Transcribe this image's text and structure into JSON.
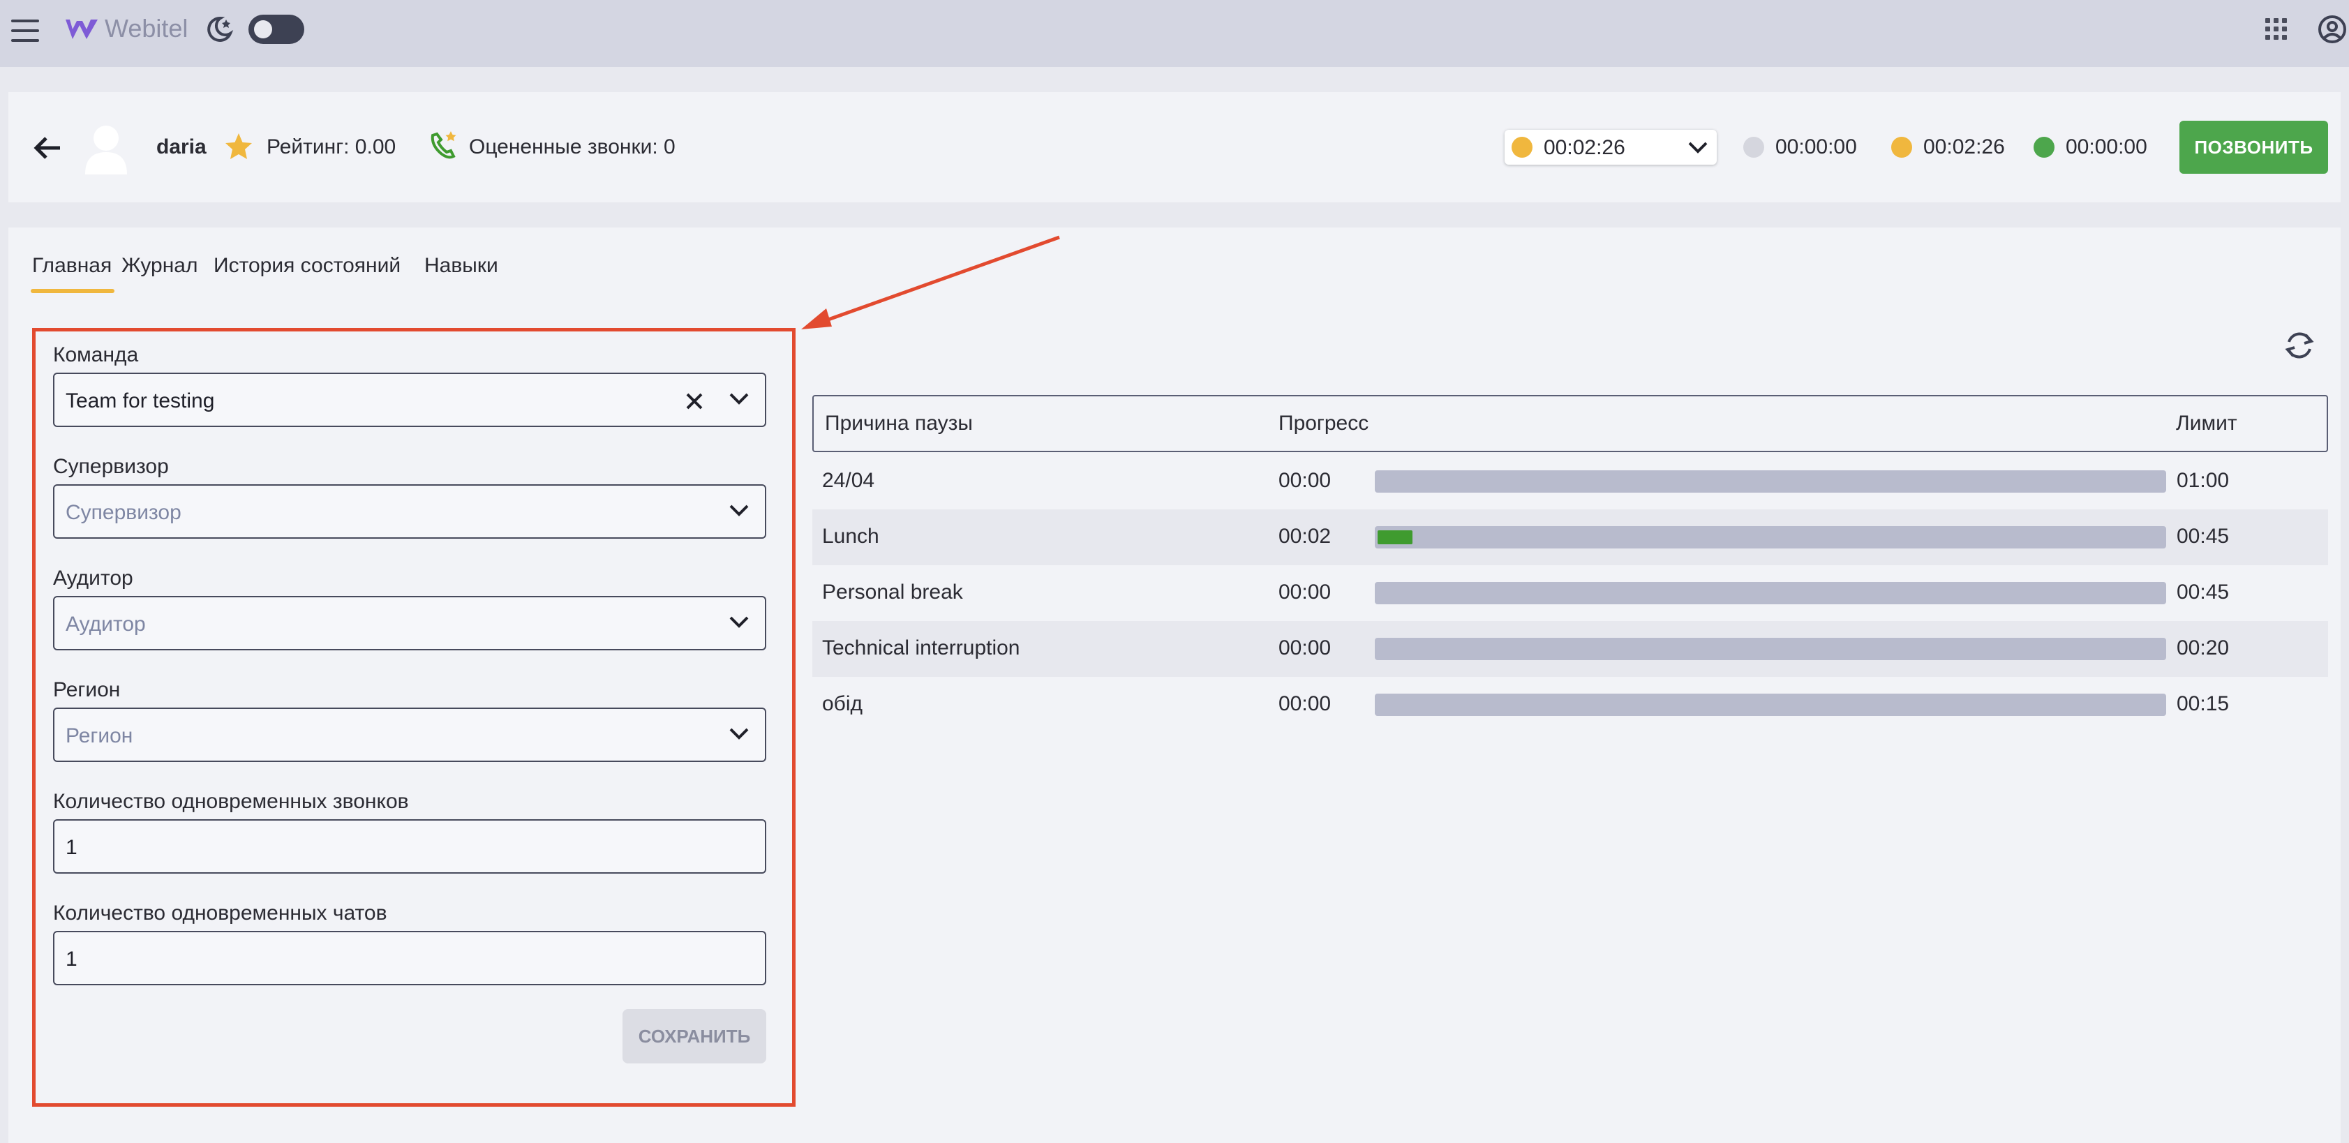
{
  "app": {
    "brand": "Webitel"
  },
  "colors": {
    "accent": "#f0b73e",
    "call_button": "#4da64c",
    "highlight": "#e24a2f",
    "progress_fill": "#3f9b2f"
  },
  "agent": {
    "name": "daria",
    "rating": "Рейтинг: 0.00",
    "rated_calls": "Оцененные звонки: 0",
    "status_time": "00:02:26",
    "timers": [
      {
        "color": "#d5d6de",
        "time": "00:00:00"
      },
      {
        "color": "#f0b73e",
        "time": "00:02:26"
      },
      {
        "color": "#4da64c",
        "time": "00:00:00"
      }
    ],
    "call_label": "ПОЗВОНИТЬ"
  },
  "tabs": [
    "Главная",
    "Журнал",
    "История состояний",
    "Навыки"
  ],
  "form": {
    "team": {
      "label": "Команда",
      "value": "Team for testing"
    },
    "supervisor": {
      "label": "Супервизор",
      "placeholder": "Супервизор"
    },
    "auditor": {
      "label": "Аудитор",
      "placeholder": "Аудитор"
    },
    "region": {
      "label": "Регион",
      "placeholder": "Регион"
    },
    "calls": {
      "label": "Количество одновременных звонков",
      "value": "1"
    },
    "chats": {
      "label": "Количество одновременных чатов",
      "value": "1"
    },
    "save_label": "СОХРАНИТЬ"
  },
  "pause_table": {
    "headers": {
      "reason": "Причина паузы",
      "progress": "Прогресс",
      "limit": "Лимит"
    },
    "rows": [
      {
        "reason": "24/04",
        "used": "00:00",
        "progress": 0,
        "limit": "01:00"
      },
      {
        "reason": "Lunch",
        "used": "00:02",
        "progress": 0.044,
        "limit": "00:45"
      },
      {
        "reason": "Personal break",
        "used": "00:00",
        "progress": 0,
        "limit": "00:45"
      },
      {
        "reason": "Technical interruption",
        "used": "00:00",
        "progress": 0,
        "limit": "00:20"
      },
      {
        "reason": "обід",
        "used": "00:00",
        "progress": 0,
        "limit": "00:15"
      }
    ]
  }
}
